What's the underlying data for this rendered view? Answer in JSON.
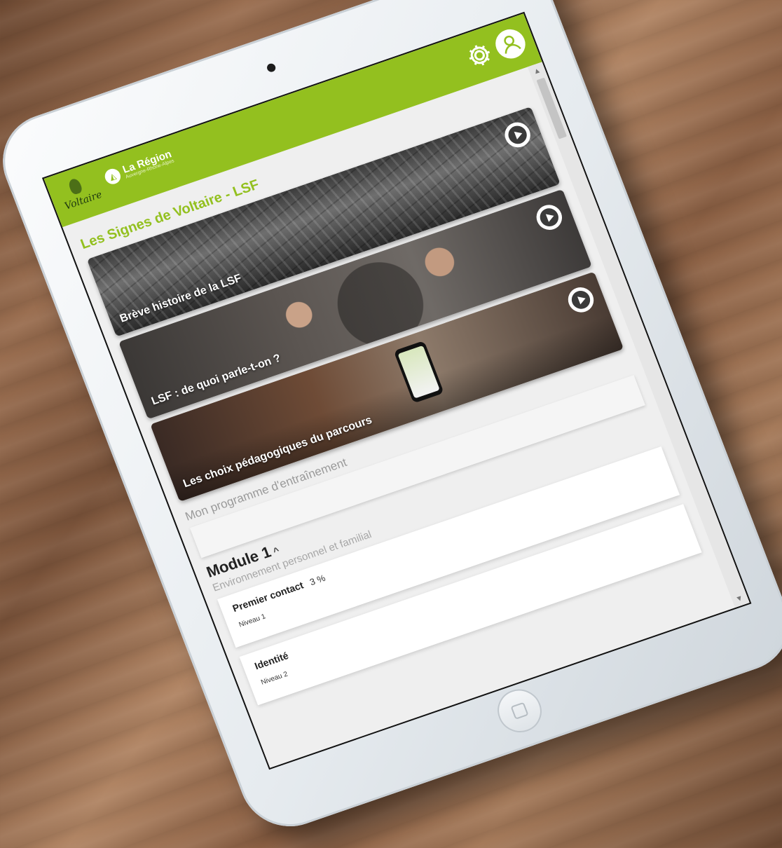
{
  "app": {
    "brand_logo_text": "Voltaire",
    "region_title": "La Région",
    "region_subtitle": "Auvergne-Rhône-Alpes",
    "page_title": "Les Signes de Voltaire - LSF"
  },
  "videos": [
    {
      "label": "Brève histoire de la LSF"
    },
    {
      "label": "LSF : de quoi parle-t-on ?"
    },
    {
      "label": "Les choix pédagogiques du parcours"
    }
  ],
  "program": {
    "section_title": "Mon programme d'entraînement",
    "module_title": "Module 1",
    "module_caret": "^",
    "module_subtitle": "Environnement personnel et familial",
    "lessons": [
      {
        "title": "Premier contact",
        "percent": "3 %",
        "level": "Niveau 1"
      },
      {
        "title": "Identité",
        "percent": "",
        "level": "Niveau 2"
      }
    ]
  },
  "colors": {
    "accent": "#93c01f",
    "background": "#efefef"
  },
  "icons": {
    "settings": "gear-icon",
    "user": "user-icon",
    "play": "play-icon"
  }
}
